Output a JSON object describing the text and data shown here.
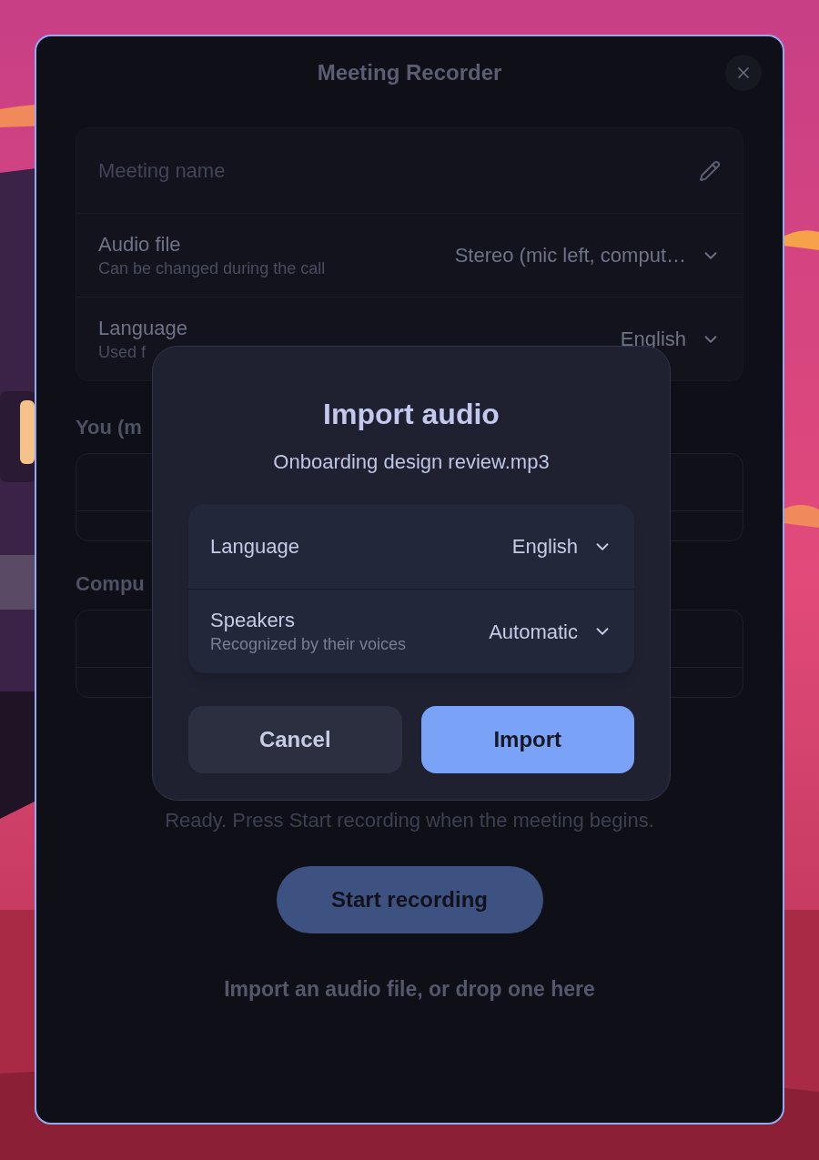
{
  "window": {
    "title": "Meeting Recorder"
  },
  "settings": [
    {
      "kind": "field",
      "placeholder": "Meeting name"
    },
    {
      "kind": "select",
      "label": "Audio file",
      "hint": "Can be changed during the call",
      "value": "Stereo (mic left, comput…"
    },
    {
      "kind": "select",
      "label": "Language",
      "hint": "Used f",
      "value": "English"
    }
  ],
  "sections": [
    {
      "heading": "You (m"
    },
    {
      "heading": "Compu"
    }
  ],
  "status": "Ready. Press Start recording when the meeting begins.",
  "start_button": "Start recording",
  "import_link": "Import an audio file, or drop one here",
  "dialog": {
    "title": "Import audio",
    "filename": "Onboarding design review.mp3",
    "options": [
      {
        "label": "Language",
        "value": "English"
      },
      {
        "label": "Speakers",
        "hint": "Recognized by their voices",
        "value": "Automatic"
      }
    ],
    "buttons": [
      {
        "kind": "secondary",
        "label": "Cancel"
      },
      {
        "kind": "primary",
        "label": "Import"
      }
    ]
  }
}
